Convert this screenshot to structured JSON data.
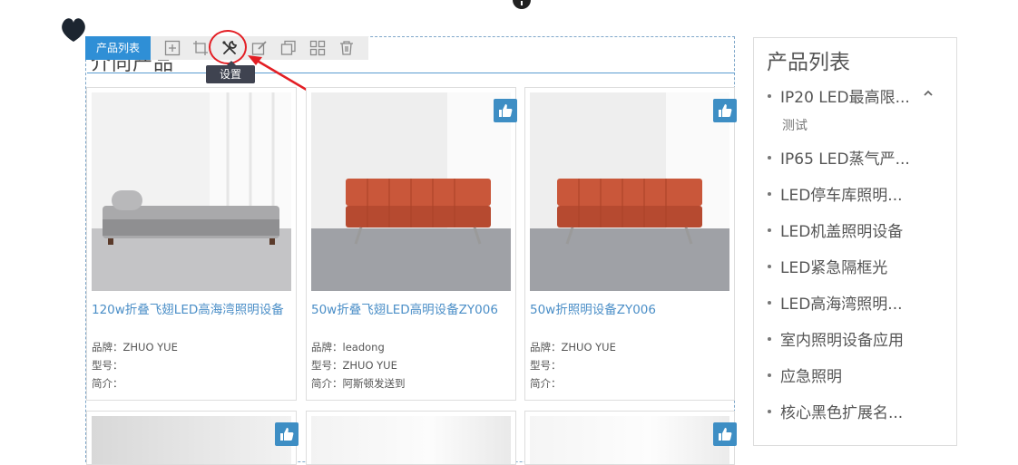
{
  "toolbar": {
    "tag_label": "产品列表",
    "tooltip": "设置",
    "icons": [
      "add-icon",
      "crop-icon",
      "settings-icon",
      "edit-icon",
      "copy-icon",
      "grid-icon",
      "delete-icon"
    ]
  },
  "module": {
    "heading_fragment": "介同产品"
  },
  "products": [
    {
      "title": "120w折叠飞翅LED高海湾照明设备",
      "brand_label": "品牌：",
      "brand": "ZHUO YUE",
      "model_label": "型号：",
      "model": "",
      "desc_label": "简介：",
      "desc": ""
    },
    {
      "title": "50w折叠飞翅LED高明设备ZY006",
      "brand_label": "品牌：",
      "brand": "leadong",
      "model_label": "型号：",
      "model": "ZHUO YUE",
      "desc_label": "简介：",
      "desc": "阿斯顿发送到"
    },
    {
      "title": "50w折照明设备ZY006",
      "brand_label": "品牌：",
      "brand": "ZHUO YUE",
      "model_label": "型号：",
      "model": "",
      "desc_label": "简介：",
      "desc": ""
    }
  ],
  "sidebar": {
    "title": "产品列表",
    "items": [
      {
        "label": "IP20 LED最高限..."
      },
      {
        "label": "测试"
      },
      {
        "label": "IP65 LED蒸气严..."
      },
      {
        "label": "LED停车库照明..."
      },
      {
        "label": "LED机盖照明设备"
      },
      {
        "label": "LED紧急隔框光"
      },
      {
        "label": "LED高海湾照明..."
      },
      {
        "label": "室内照明设备应用"
      },
      {
        "label": "应急照明"
      },
      {
        "label": "核心黑色扩展名..."
      }
    ]
  },
  "colors": {
    "accent": "#2f8fd6",
    "link": "#4a8ec7",
    "annotation": "#e31e24",
    "sofa_orange": "#c9573a"
  }
}
